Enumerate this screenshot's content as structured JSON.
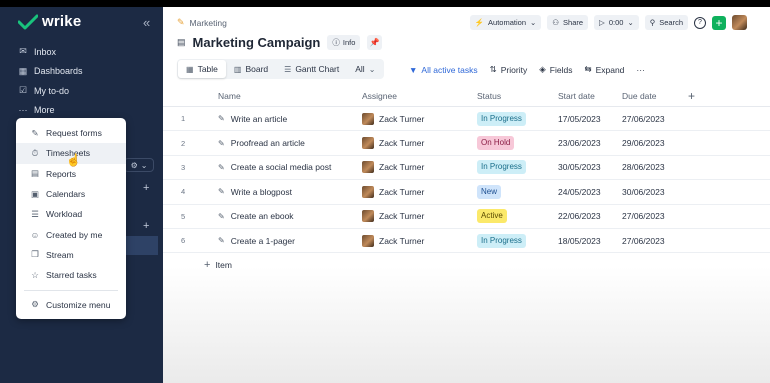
{
  "app": {
    "logo": "wrike",
    "collapse_icon": "double-chevron-left-icon"
  },
  "sidebar": {
    "items": [
      {
        "label": "Inbox",
        "icon": "inbox-icon"
      },
      {
        "label": "Dashboards",
        "icon": "dashboard-icon"
      },
      {
        "label": "My to-do",
        "icon": "todo-icon"
      },
      {
        "label": "More",
        "icon": "more-icon"
      }
    ]
  },
  "more_menu": {
    "items": [
      {
        "label": "Request forms",
        "icon": "request-forms-icon"
      },
      {
        "label": "Timesheets",
        "icon": "timesheets-icon"
      },
      {
        "label": "Reports",
        "icon": "reports-icon"
      },
      {
        "label": "Calendars",
        "icon": "calendar-icon"
      },
      {
        "label": "Workload",
        "icon": "workload-icon"
      },
      {
        "label": "Created by me",
        "icon": "created-by-me-icon"
      },
      {
        "label": "Stream",
        "icon": "stream-icon"
      },
      {
        "label": "Starred tasks",
        "icon": "star-icon"
      }
    ],
    "customize": {
      "label": "Customize menu",
      "icon": "gear-icon"
    },
    "hovered": "Timesheets"
  },
  "header": {
    "breadcrumb": "Marketing",
    "title": "Marketing Campaign",
    "info_label": "Info",
    "automation_label": "Automation",
    "share_label": "Share",
    "timer": "0:00",
    "search_label": "Search"
  },
  "views": {
    "tabs": [
      {
        "label": "Table",
        "icon": "table-icon",
        "active": true
      },
      {
        "label": "Board",
        "icon": "board-icon",
        "active": false
      },
      {
        "label": "Gantt Chart",
        "icon": "gantt-icon",
        "active": false
      },
      {
        "label": "All",
        "icon": "",
        "active": false
      }
    ],
    "filter_label": "All active tasks",
    "priority_label": "Priority",
    "fields_label": "Fields",
    "expand_label": "Expand",
    "more_label": "···"
  },
  "table": {
    "columns": {
      "name": "Name",
      "assignee": "Assignee",
      "status": "Status",
      "start": "Start date",
      "due": "Due date"
    },
    "rows": [
      {
        "num": "1",
        "name": "Write an article",
        "assignee": "Zack Turner",
        "status": "In Progress",
        "start": "17/05/2023",
        "due": "27/06/2023"
      },
      {
        "num": "2",
        "name": "Proofread an article",
        "assignee": "Zack Turner",
        "status": "On Hold",
        "start": "23/06/2023",
        "due": "29/06/2023"
      },
      {
        "num": "3",
        "name": "Create a social media post",
        "assignee": "Zack Turner",
        "status": "In Progress",
        "start": "30/05/2023",
        "due": "28/06/2023"
      },
      {
        "num": "4",
        "name": "Write a blogpost",
        "assignee": "Zack Turner",
        "status": "New",
        "start": "24/05/2023",
        "due": "30/06/2023"
      },
      {
        "num": "5",
        "name": "Create an ebook",
        "assignee": "Zack Turner",
        "status": "Active",
        "start": "22/06/2023",
        "due": "27/06/2023"
      },
      {
        "num": "6",
        "name": "Create a 1-pager",
        "assignee": "Zack Turner",
        "status": "In Progress",
        "start": "18/05/2023",
        "due": "27/06/2023"
      }
    ],
    "add_item_label": "Item"
  },
  "status_colors": {
    "In Progress": {
      "bg": "#cdeef7",
      "fg": "#1a6e8a"
    },
    "On Hold": {
      "bg": "#f7c8d8",
      "fg": "#8a1c44"
    },
    "New": {
      "bg": "#cfe4fb",
      "fg": "#1d4f91"
    },
    "Active": {
      "bg": "#fbe96a",
      "fg": "#5a4a00"
    }
  },
  "colors": {
    "sidebar_bg": "#1c2a44",
    "accent_green": "#0fb15d",
    "accent_blue": "#2f68d8"
  }
}
